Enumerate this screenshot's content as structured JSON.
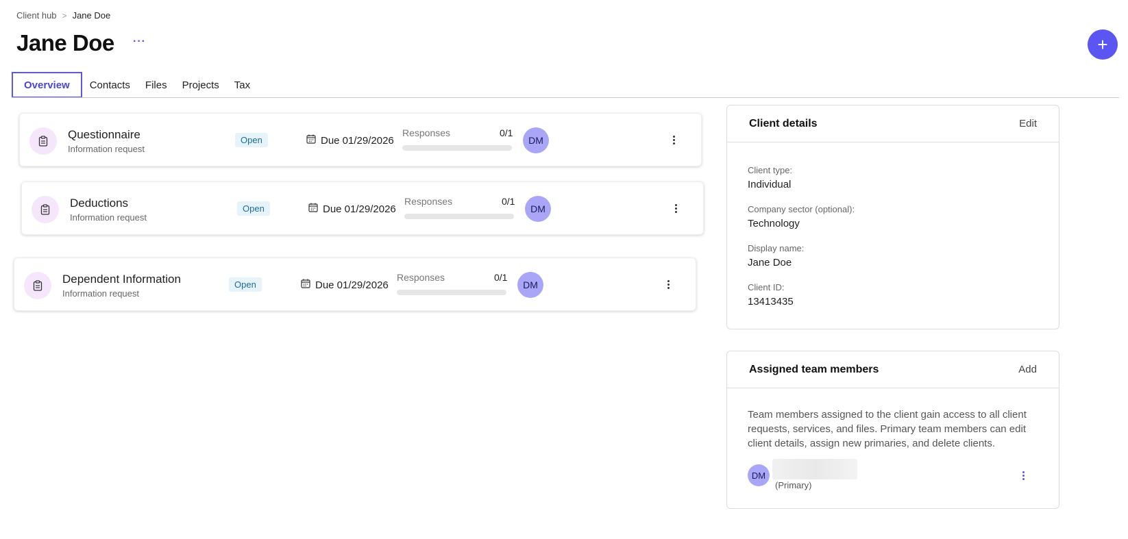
{
  "breadcrumb": {
    "parent": "Client hub",
    "separator": ">",
    "current": "Jane Doe"
  },
  "page": {
    "title": "Jane Doe",
    "more_label": "···"
  },
  "fab": {
    "label": "+"
  },
  "tabs": [
    {
      "label": "Overview",
      "active": true
    },
    {
      "label": "Contacts",
      "active": false
    },
    {
      "label": "Files",
      "active": false
    },
    {
      "label": "Projects",
      "active": false
    },
    {
      "label": "Tax",
      "active": false
    }
  ],
  "requests": [
    {
      "title": "Questionnaire",
      "subtitle": "Information request",
      "status": "Open",
      "due": "Due 01/29/2026",
      "responses_label": "Responses",
      "responses_count": "0/1",
      "progress": 0,
      "assignee": "DM"
    },
    {
      "title": "Deductions",
      "subtitle": "Information request",
      "status": "Open",
      "due": "Due 01/29/2026",
      "responses_label": "Responses",
      "responses_count": "0/1",
      "progress": 0,
      "assignee": "DM"
    },
    {
      "title": "Dependent Information",
      "subtitle": "Information request",
      "status": "Open",
      "due": "Due 01/29/2026",
      "responses_label": "Responses",
      "responses_count": "0/1",
      "progress": 0,
      "assignee": "DM"
    }
  ],
  "client_details": {
    "title": "Client details",
    "action": "Edit",
    "fields": [
      {
        "label": "Client type:",
        "value": "Individual"
      },
      {
        "label": "Company sector (optional):",
        "value": "Technology"
      },
      {
        "label": "Display name:",
        "value": "Jane Doe"
      },
      {
        "label": "Client ID:",
        "value": "13413435"
      }
    ]
  },
  "team": {
    "title": "Assigned team members",
    "action": "Add",
    "description": "Team members assigned to the client gain access to all client requests, services, and files. Primary team members can edit client details, assign new primaries, and delete clients.",
    "members": [
      {
        "initials": "DM",
        "role": "(Primary)"
      }
    ]
  },
  "colors": {
    "accent": "#5b55f2",
    "avatar": "#a9a6f7",
    "badge_bg": "#e6f3fb",
    "badge_text": "#1e6b99",
    "icon_bg": "#f6e6fb"
  }
}
